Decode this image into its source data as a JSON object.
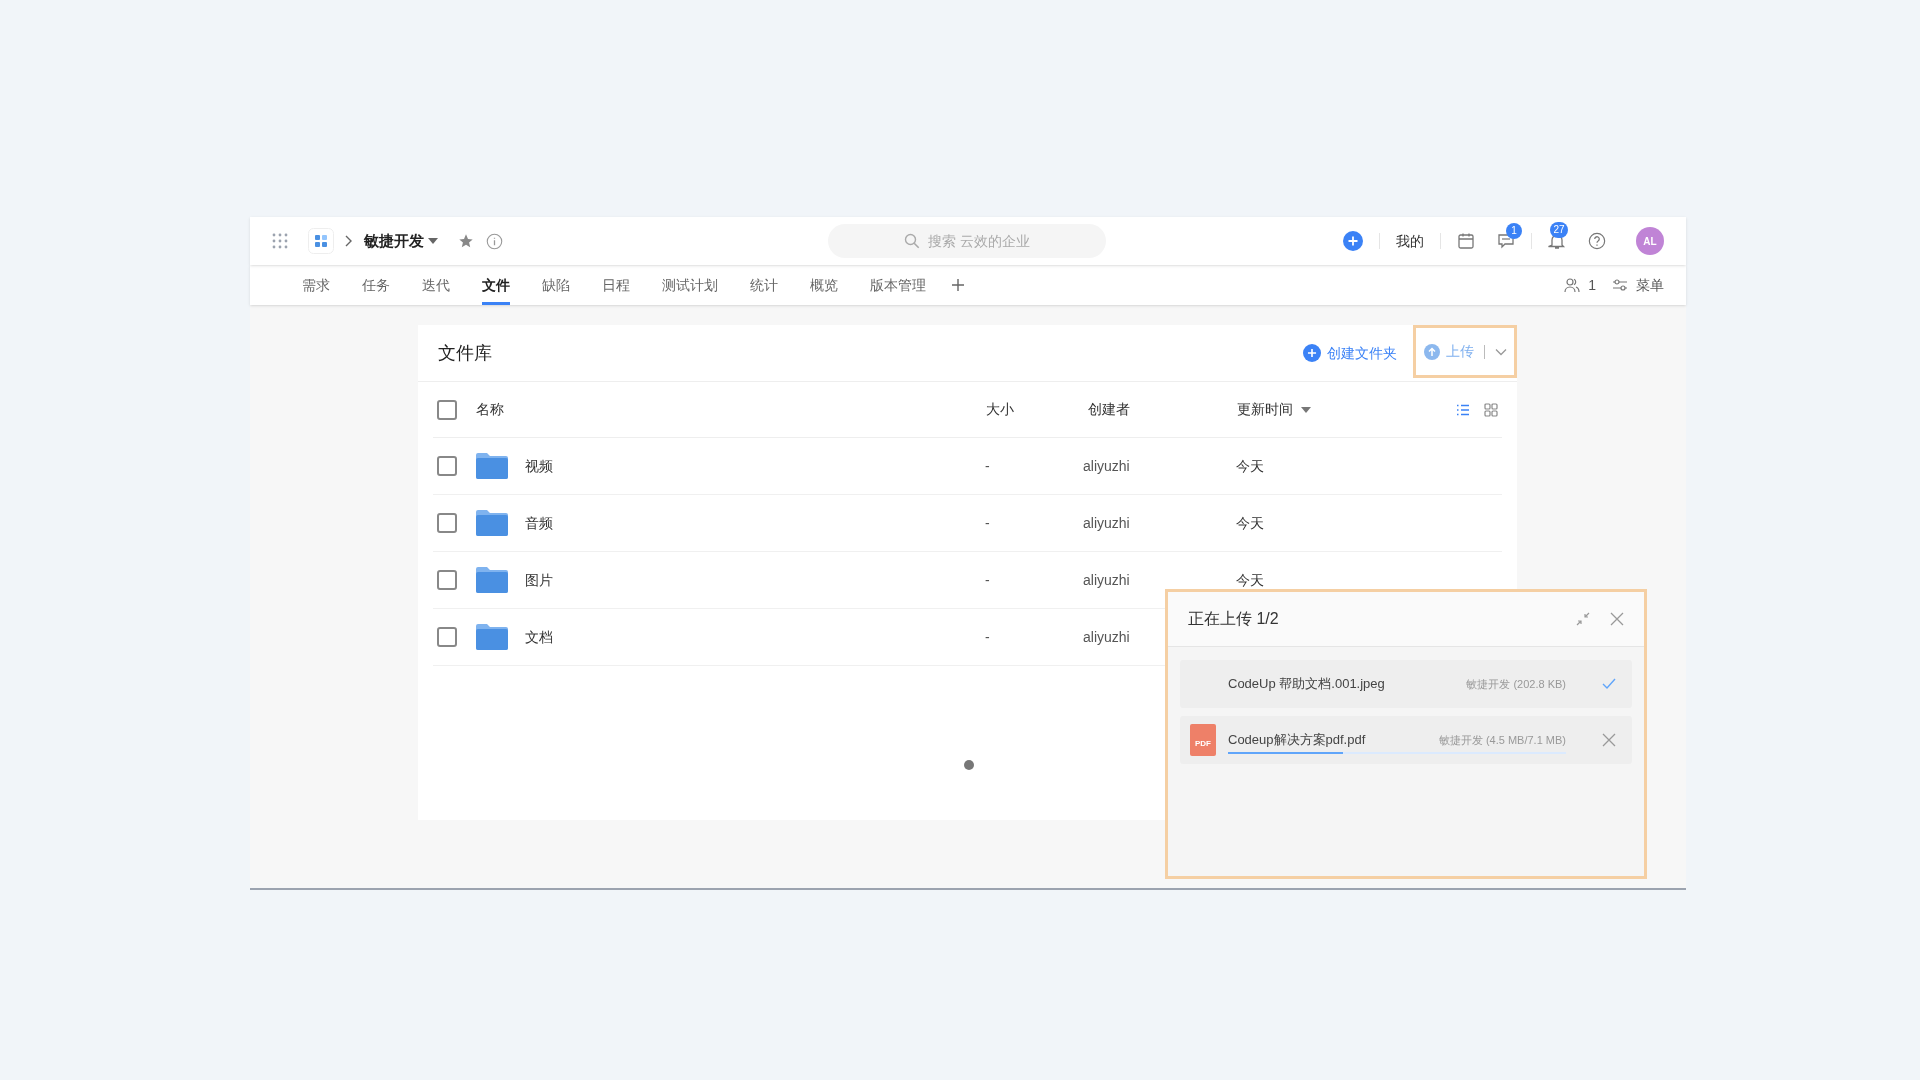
{
  "top_bar": {
    "project": "敏捷开发",
    "search": {
      "placeholder": "搜索 云效的企业"
    },
    "my_label": "我的",
    "chat_badge": "1",
    "bell_badge": "27",
    "avatar": "AL"
  },
  "tabs": [
    {
      "label": "需求",
      "selected": false
    },
    {
      "label": "任务",
      "selected": false
    },
    {
      "label": "迭代",
      "selected": false
    },
    {
      "label": "文件",
      "selected": true
    },
    {
      "label": "缺陷",
      "selected": false
    },
    {
      "label": "日程",
      "selected": false
    },
    {
      "label": "测试计划",
      "selected": false
    },
    {
      "label": "统计",
      "selected": false
    },
    {
      "label": "概览",
      "selected": false
    },
    {
      "label": "版本管理",
      "selected": false
    }
  ],
  "members_count": "1",
  "menu_label": "菜单",
  "library": {
    "title": "文件库",
    "create_folder": "创建文件夹",
    "upload": "上传",
    "select_all": {
      "checked": false
    },
    "columns": [
      "名称",
      "大小",
      "创建者",
      "更新时间"
    ],
    "views": [
      {
        "kind": "list",
        "selected": true
      },
      {
        "kind": "grid",
        "selected": false
      }
    ],
    "rows": [
      {
        "name": "视频",
        "size": "-",
        "creator": "aliyuzhi",
        "updated": "今天",
        "checked": false
      },
      {
        "name": "音频",
        "size": "-",
        "creator": "aliyuzhi",
        "updated": "今天",
        "checked": false
      },
      {
        "name": "图片",
        "size": "-",
        "creator": "aliyuzhi",
        "updated": "今天",
        "checked": false
      },
      {
        "name": "文档",
        "size": "-",
        "creator": "aliyuzhi",
        "checked": false
      }
    ]
  },
  "upload_panel": {
    "title": "正在上传 1/2",
    "files": [
      {
        "name": "CodeUp 帮助文档.001.jpeg",
        "meta": "敏捷开发 (202.8 KB)",
        "done": true
      },
      {
        "name": "Codeup解决方案pdf.pdf",
        "meta": "敏捷开发 (4.5 MB/7.1 MB)",
        "done": false,
        "level": 0.34,
        "icon_label": "PDF"
      }
    ]
  }
}
